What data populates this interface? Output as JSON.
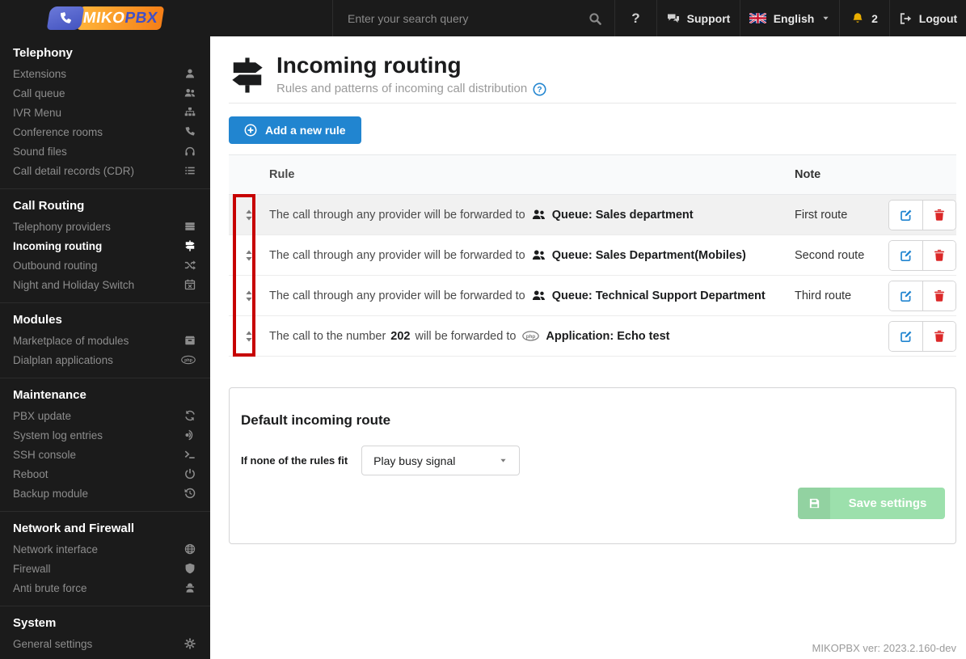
{
  "brand": {
    "miko": "MIKO",
    "pbx": "PBX"
  },
  "topbar": {
    "search_placeholder": "Enter your search query",
    "help_label": "?",
    "support_label": "Support",
    "language_label": "English",
    "notification_count": "2",
    "logout_label": "Logout"
  },
  "sidebar": {
    "sections": [
      {
        "title": "Telephony",
        "items": [
          {
            "label": "Extensions",
            "icon": "user-icon"
          },
          {
            "label": "Call queue",
            "icon": "users-icon"
          },
          {
            "label": "IVR Menu",
            "icon": "sitemap-icon"
          },
          {
            "label": "Conference rooms",
            "icon": "phone-icon"
          },
          {
            "label": "Sound files",
            "icon": "headphones-icon"
          },
          {
            "label": "Call detail records (CDR)",
            "icon": "list-icon"
          }
        ]
      },
      {
        "title": "Call Routing",
        "items": [
          {
            "label": "Telephony providers",
            "icon": "rows-icon"
          },
          {
            "label": "Incoming routing",
            "icon": "signpost-icon",
            "active": true
          },
          {
            "label": "Outbound routing",
            "icon": "shuffle-icon"
          },
          {
            "label": "Night and Holiday Switch",
            "icon": "calendar-icon"
          }
        ]
      },
      {
        "title": "Modules",
        "items": [
          {
            "label": "Marketplace of modules",
            "icon": "box-icon"
          },
          {
            "label": "Dialplan applications",
            "icon": "php-icon"
          }
        ]
      },
      {
        "title": "Maintenance",
        "items": [
          {
            "label": "PBX update",
            "icon": "sync-icon"
          },
          {
            "label": "System log entries",
            "icon": "phone-volume-icon"
          },
          {
            "label": "SSH console",
            "icon": "terminal-icon"
          },
          {
            "label": "Reboot",
            "icon": "power-icon"
          },
          {
            "label": "Backup module",
            "icon": "history-icon"
          }
        ]
      },
      {
        "title": "Network and Firewall",
        "items": [
          {
            "label": "Network interface",
            "icon": "globe-icon"
          },
          {
            "label": "Firewall",
            "icon": "shield-icon"
          },
          {
            "label": "Anti brute force",
            "icon": "spy-icon"
          }
        ]
      },
      {
        "title": "System",
        "items": [
          {
            "label": "General settings",
            "icon": "gears-icon"
          }
        ]
      }
    ]
  },
  "page": {
    "title": "Incoming routing",
    "subtitle": "Rules and patterns of incoming call distribution",
    "add_rule_button": "Add a new rule"
  },
  "routes_table": {
    "rule_header": "Rule",
    "note_header": "Note",
    "rows": [
      {
        "text_before": "The call through any provider will be forwarded to",
        "bold_number": "",
        "text_after": "",
        "target_icon": "users-icon",
        "target": "Queue: Sales department",
        "note": "First route"
      },
      {
        "text_before": "The call through any provider will be forwarded to",
        "bold_number": "",
        "text_after": "",
        "target_icon": "users-icon",
        "target": "Queue: Sales Department(Mobiles)",
        "note": "Second route"
      },
      {
        "text_before": "The call through any provider will be forwarded to",
        "bold_number": "",
        "text_after": "",
        "target_icon": "users-icon",
        "target": "Queue: Technical Support Department",
        "note": "Third route"
      },
      {
        "text_before": "The call to the number",
        "bold_number": "202",
        "text_after": "will be forwarded to",
        "target_icon": "php-icon",
        "target": "Application: Echo test",
        "note": ""
      }
    ]
  },
  "default_route": {
    "title": "Default incoming route",
    "label": "If none of the rules fit",
    "selected_option": "Play busy signal",
    "save_button": "Save settings"
  },
  "footer": {
    "version": "MIKOPBX ver: 2023.2.160-dev"
  },
  "colors": {
    "sidebar_bg": "#1b1b1b",
    "accent_blue": "#2185d0",
    "danger_red": "#db2828",
    "annotation_red": "#c70000",
    "bell_yellow": "#eaae00",
    "save_green_disabled": "#9ce0ac",
    "logo_orange": "#f57f17",
    "logo_blue": "#4353c0"
  }
}
